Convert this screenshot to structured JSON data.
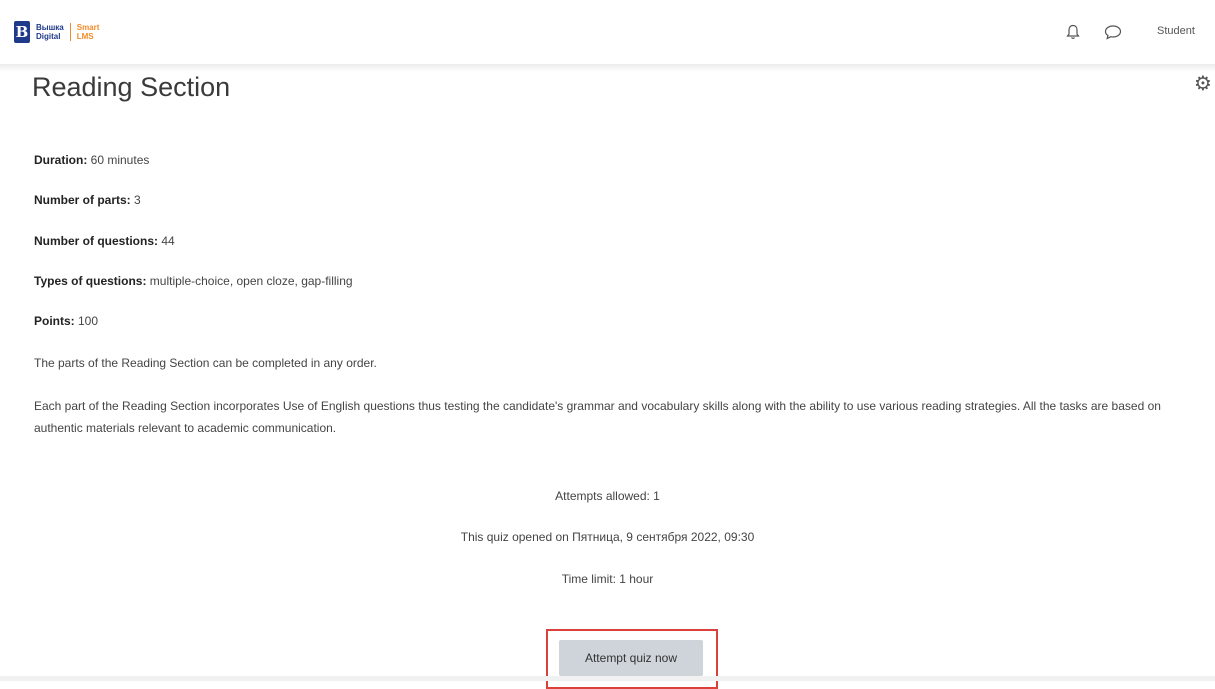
{
  "header": {
    "logo_line1": "Вышка",
    "logo_line2": "Digital",
    "logo_sub1": "Smart",
    "logo_sub2": "LMS",
    "user_label": "Student"
  },
  "page": {
    "title": "Reading Section"
  },
  "details": [
    {
      "label": "Duration:",
      "value": " 60 minutes"
    },
    {
      "label": "Number of parts:",
      "value": " 3"
    },
    {
      "label": "Number of questions:",
      "value": " 44"
    },
    {
      "label": "Types of questions:",
      "value": " multiple-choice, open cloze, gap-filling"
    },
    {
      "label": "Points:",
      "value": " 100"
    }
  ],
  "paragraphs": {
    "order_note": "The parts of the Reading Section can be completed in any order.",
    "description": "Each part of the Reading Section incorporates Use of English questions thus testing the candidate's grammar and vocabulary skills along with the ability to use various reading strategies. All the tasks are based on authentic materials relevant to academic communication."
  },
  "quiz_info": {
    "attempts": "Attempts allowed: 1",
    "opened": "This quiz opened on Пятница, 9 сентября 2022, 09:30",
    "time_limit": "Time limit: 1 hour"
  },
  "actions": {
    "attempt_label": "Attempt quiz now"
  },
  "icons": {
    "bell": "bell-icon",
    "chat": "chat-icon",
    "gear": "gear-icon"
  },
  "colors": {
    "brand": "#1f3a8a",
    "accent": "#f28c28",
    "highlight": "#d9413a"
  }
}
